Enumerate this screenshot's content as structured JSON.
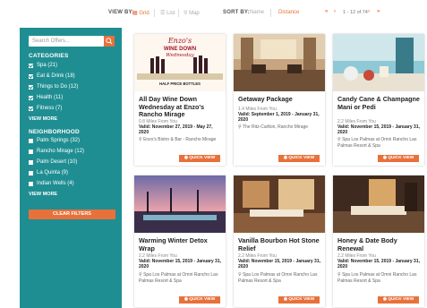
{
  "topbar": {
    "view_by_label": "VIEW BY:",
    "view_options": [
      "Grid",
      "List",
      "Map"
    ],
    "sort_by_label": "SORT BY:",
    "sort_options": [
      "Name",
      "Distance"
    ],
    "pager_text": "1 - 12 of 74"
  },
  "sidebar": {
    "search_placeholder": "Search Offers...",
    "categories_title": "CATEGORIES",
    "categories": [
      {
        "label": "Spa (21)",
        "checked": true
      },
      {
        "label": "Eat & Drink (18)",
        "checked": true
      },
      {
        "label": "Things to Do (12)",
        "checked": true
      },
      {
        "label": "Health (11)",
        "checked": true
      },
      {
        "label": "Fitness (7)",
        "checked": true
      }
    ],
    "view_more_1": "VIEW MORE",
    "neighborhood_title": "NEIGHBORHOOD",
    "neighborhoods": [
      {
        "label": "Palm Springs (32)",
        "checked": false
      },
      {
        "label": "Rancho Mirage (12)",
        "checked": false
      },
      {
        "label": "Palm Desert (10)",
        "checked": false
      },
      {
        "label": "La Quinta (9)",
        "checked": false
      },
      {
        "label": "Indian Wells (4)",
        "checked": false
      }
    ],
    "view_more_2": "VIEW MORE",
    "clear_filters": "CLEAR FILTERS"
  },
  "cards": [
    {
      "title": "All Day Wine Down Wednesday at Enzo's Rancho Mirage",
      "distance": "0.8 Miles From You",
      "valid_label": "Valid:",
      "valid_text": "November 27, 2019 - May 27, 2020",
      "location": "Enzo's Bistro & Bar - Rancho Mirage",
      "quick_view": "QUICK VIEW",
      "poster_lines": [
        "Enzo's",
        "WINE DOWN",
        "Wednesday",
        "HALF PRICE BOTTLES"
      ]
    },
    {
      "title": "Getaway Package",
      "distance": "1.4 Miles From You",
      "valid_label": "Valid:",
      "valid_text": "September 1, 2019 - January 31, 2020",
      "location": "The Ritz-Carlton, Rancho Mirage",
      "quick_view": "QUICK VIEW"
    },
    {
      "title": "Candy Cane & Champagne Mani or Pedi",
      "distance": "2.2 Miles From You",
      "valid_label": "Valid:",
      "valid_text": "November 15, 2019 - January 31, 2020",
      "location": "Spa Los Palmas at Omni Rancho Las Palmas Resort & Spa",
      "quick_view": "QUICK VIEW"
    },
    {
      "title": "Warming Winter Detox Wrap",
      "distance": "2.2 Miles From You",
      "valid_label": "Valid:",
      "valid_text": "November 15, 2019 - January 31, 2020",
      "location": "Spa Los Palmas at Omni Rancho Las Palmas Resort & Spa",
      "quick_view": "QUICK VIEW"
    },
    {
      "title": "Vanilla Bourbon Hot Stone Relief",
      "distance": "2.2 Miles From You",
      "valid_label": "Valid:",
      "valid_text": "November 15, 2019 - January 31, 2020",
      "location": "Spa Los Palmas at Omni Rancho Las Palmas Resort & Spa",
      "quick_view": "QUICK VIEW"
    },
    {
      "title": "Honey & Date Body Renewal",
      "distance": "2.2 Miles From You",
      "valid_label": "Valid:",
      "valid_text": "November 15, 2019 - January 31, 2020",
      "location": "Spa Los Palmas at Omni Rancho Las Palmas Resort & Spa",
      "quick_view": "QUICK VIEW"
    }
  ],
  "colors": {
    "accent": "#e8703a",
    "sidebar": "#1f8e92"
  },
  "icons": [
    "grid-icon",
    "list-icon",
    "map-pin-icon",
    "search-icon",
    "first-page-icon",
    "prev-page-icon",
    "next-page-icon",
    "last-page-icon",
    "location-pin-icon",
    "checkbox-icon"
  ]
}
